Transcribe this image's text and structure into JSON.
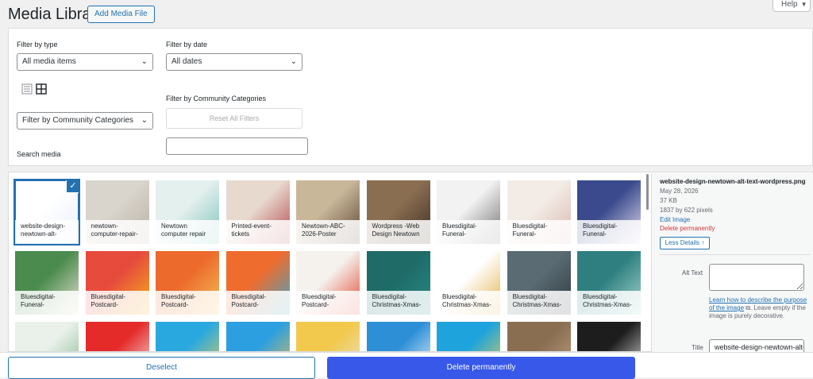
{
  "header": {
    "title": "Media Library",
    "add_button": "Add Media File",
    "help": "Help",
    "help_caret": "▼"
  },
  "filters": {
    "type_label": "Filter by type",
    "type_value": "All media items",
    "date_label": "Filter by date",
    "date_value": "All dates",
    "community_label": "Filter by Community Categories",
    "community_select_value": "Filter by Community Categories",
    "reset_label": "Reset All Filters",
    "search_label": "Search media",
    "search_value": "",
    "chevron": "⌄"
  },
  "media_items": [
    {
      "name": "website-design-newtown-alt-",
      "selected": true,
      "colors": [
        "#ffffff",
        "#e7eefb"
      ]
    },
    {
      "name": "newtown-computer-repair-",
      "colors": [
        "#d9d4cc",
        "#b9b1a4"
      ]
    },
    {
      "name": "Newtown computer repair",
      "colors": [
        "#e3f0ee",
        "#7fc3bd"
      ]
    },
    {
      "name": "Printed-event-tickets",
      "colors": [
        "#e8d9cf",
        "#b3474a"
      ]
    },
    {
      "name": "Newtown-ABC-2026-Poster",
      "colors": [
        "#c9b79a",
        "#5a4632"
      ]
    },
    {
      "name": "Wordpress -Web Design Newtown",
      "colors": [
        "#8a6e52",
        "#3f3024"
      ]
    },
    {
      "name": "Bluesdigital-Funeral-",
      "colors": [
        "#f2f2f2",
        "#6f6f6f"
      ]
    },
    {
      "name": "Bluesdigital-Funeral-",
      "colors": [
        "#f3ece6",
        "#d8b8b0"
      ]
    },
    {
      "name": "Bluesdigital-Funeral-",
      "colors": [
        "#3a4a8c",
        "#e6e0f0"
      ]
    },
    {
      "name": "Bluesdigital-Funeral-",
      "colors": [
        "#4b8b4e",
        "#e9e2d2"
      ]
    },
    {
      "name": "Bluesdigital-Postcard-",
      "colors": [
        "#e64b3c",
        "#f6b21a"
      ]
    },
    {
      "name": "Bluesdigital-Postcard-",
      "colors": [
        "#ec6a2b",
        "#f4c25a"
      ]
    },
    {
      "name": "Bluesdigital-Postcard-",
      "colors": [
        "#ef6c2f",
        "#3ea6c8"
      ]
    },
    {
      "name": "Bluesdigital-Postcard-",
      "colors": [
        "#f5f2ee",
        "#e0452f"
      ]
    },
    {
      "name": "Bluesdigital-Christmas-Xmas-",
      "colors": [
        "#1e6b68",
        "#2a8a84"
      ]
    },
    {
      "name": "Bluesdigital-Christmas-Xmas-",
      "colors": [
        "#ffffff",
        "#e4b04b"
      ]
    },
    {
      "name": "Bluesdigital-Christmas-Xmas-",
      "colors": [
        "#5a6b73",
        "#2f3b40"
      ]
    },
    {
      "name": "Bluesdigital-Christmas-Xmas-",
      "colors": [
        "#2f7f80",
        "#a9d6d2"
      ]
    },
    {
      "name": "",
      "colors": [
        "#e9f1ea",
        "#7fb48a"
      ]
    },
    {
      "name": "",
      "colors": [
        "#e52a2a",
        "#f4f4f4"
      ]
    },
    {
      "name": "",
      "colors": [
        "#29a8e0",
        "#f4d34a"
      ]
    },
    {
      "name": "",
      "colors": [
        "#2b9fe0",
        "#f3c24a"
      ]
    },
    {
      "name": "",
      "colors": [
        "#f2c94c",
        "#e9e2d2"
      ]
    },
    {
      "name": "",
      "colors": [
        "#2d8fd6",
        "#ffffff"
      ]
    },
    {
      "name": "",
      "colors": [
        "#1fa3dc",
        "#f4d34a"
      ]
    },
    {
      "name": "",
      "colors": [
        "#8a6e52",
        "#c4a382"
      ]
    },
    {
      "name": "",
      "colors": [
        "#1d1d1d",
        "#f2f2f2"
      ]
    }
  ],
  "details": {
    "filename": "website-design-newtown-alt-text-wordpress.png",
    "date": "May 28, 2026",
    "size": "37 KB",
    "dimensions": "1837 by 622 pixels",
    "edit_link": "Edit Image",
    "delete_link": "Delete permanently",
    "less_details": "Less Details ↑",
    "alt_label": "Alt Text",
    "alt_value": "",
    "alt_help_link": "Learn how to describe the purpose of the image",
    "alt_help_rest": ". Leave empty if the image is purely decorative.",
    "title_label": "Title",
    "title_value": "website-design-newtown-alt-text-wordpress"
  },
  "footer": {
    "deselect": "Deselect",
    "delete": "Delete permanently"
  },
  "colors": {
    "accent": "#2271b1",
    "danger_button": "#3858e9",
    "delete_link": "#d63638"
  }
}
